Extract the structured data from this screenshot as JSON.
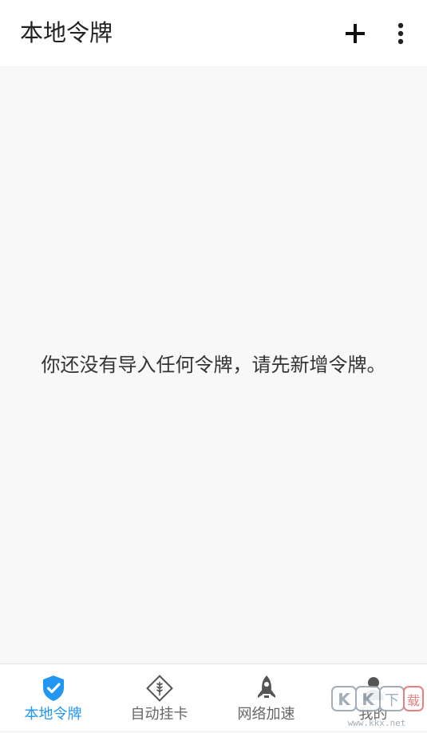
{
  "appbar": {
    "title": "本地令牌",
    "add_icon": "plus-icon",
    "more_icon": "more-vertical-icon"
  },
  "content": {
    "empty_message": "你还没有导入任何令牌，请先新增令牌。"
  },
  "bottom_nav": {
    "items": [
      {
        "label": "本地令牌",
        "icon": "shield-check-icon",
        "active": true
      },
      {
        "label": "自动挂卡",
        "icon": "wheat-diamond-icon",
        "active": false
      },
      {
        "label": "网络加速",
        "icon": "rocket-icon",
        "active": false
      },
      {
        "label": "我的",
        "icon": "person-icon",
        "active": false
      }
    ]
  },
  "watermark": {
    "text": "KK下载",
    "url": "www.kkx.net"
  },
  "colors": {
    "accent": "#2196f3",
    "inactive": "#666666",
    "background": "#f8f8f8",
    "surface": "#ffffff"
  }
}
